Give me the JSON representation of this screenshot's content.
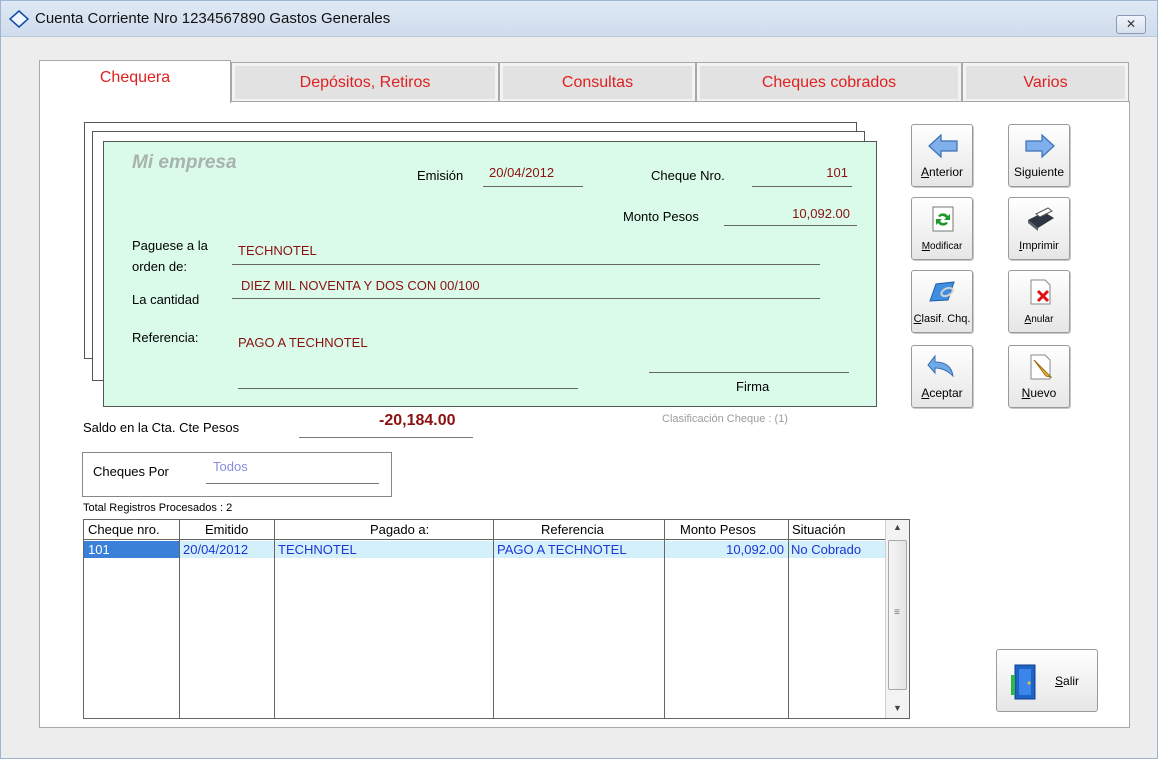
{
  "window": {
    "title": "Cuenta Corriente Nro 1234567890 Gastos Generales",
    "close_glyph": "✕"
  },
  "tabs": [
    {
      "label": "Chequera",
      "active": true
    },
    {
      "label": "Depósitos, Retiros",
      "active": false
    },
    {
      "label": "Consultas",
      "active": false
    },
    {
      "label": "Cheques cobrados",
      "active": false
    },
    {
      "label": "Varios",
      "active": false
    }
  ],
  "cheque": {
    "company": "Mi empresa",
    "emision_label": "Emisión",
    "emision_value": "20/04/2012",
    "nro_label": "Cheque Nro.",
    "nro_value": "101",
    "monto_label": "Monto Pesos",
    "monto_value": "10,092.00",
    "paguese_label_1": "Paguese a la",
    "paguese_label_2": "orden de:",
    "paguese_value": "TECHNOTEL",
    "cantidad_label": "La cantidad",
    "cantidad_value": "DIEZ MIL NOVENTA Y DOS CON 00/100",
    "referencia_label": "Referencia:",
    "referencia_value": "PAGO A TECHNOTEL",
    "firma_label": "Firma"
  },
  "clasificacion": "Clasificación Cheque : (1)",
  "saldo": {
    "label": "Saldo en la Cta. Cte Pesos",
    "value": "-20,184.00"
  },
  "filter": {
    "label": "Cheques Por",
    "value": "Todos"
  },
  "total_registros": "Total Registros Procesados  : 2",
  "buttons": {
    "anterior": {
      "first": "A",
      "rest": "nterior",
      "icon": "arrow-left-icon"
    },
    "siguiente": {
      "label": "Siguiente",
      "icon": "arrow-right-icon"
    },
    "modificar": {
      "first": "M",
      "rest": "odificar",
      "icon": "refresh-icon"
    },
    "imprimir": {
      "first": "I",
      "rest": "mprimir",
      "icon": "printer-icon"
    },
    "clasif": {
      "first": "C",
      "rest": "lasif. Chq.",
      "icon": "folder-clip-icon"
    },
    "anular": {
      "first": "A",
      "rest": "nular",
      "icon": "delete-document-icon"
    },
    "aceptar": {
      "first": "A",
      "rest": "ceptar",
      "icon": "undo-arrow-icon"
    },
    "nuevo": {
      "first": "N",
      "rest": "uevo",
      "icon": "new-document-icon"
    },
    "salir": {
      "first": "S",
      "rest": "alir",
      "icon": "exit-door-icon"
    }
  },
  "grid": {
    "columns": [
      "Cheque nro.",
      "Emitido",
      "Pagado a:",
      "Referencia",
      "Monto Pesos",
      "Situación"
    ],
    "rows": [
      [
        "101",
        "20/04/2012",
        "TECHNOTEL",
        "PAGO A TECHNOTEL",
        "10,092.00",
        "No Cobrado"
      ]
    ]
  },
  "colors": {
    "tab_text": "#e02020",
    "cheque_bg": "#dafbea",
    "value_maroon": "#8b1010",
    "grid_text": "#1d35d6",
    "row_selected": "#d4f1fb"
  }
}
